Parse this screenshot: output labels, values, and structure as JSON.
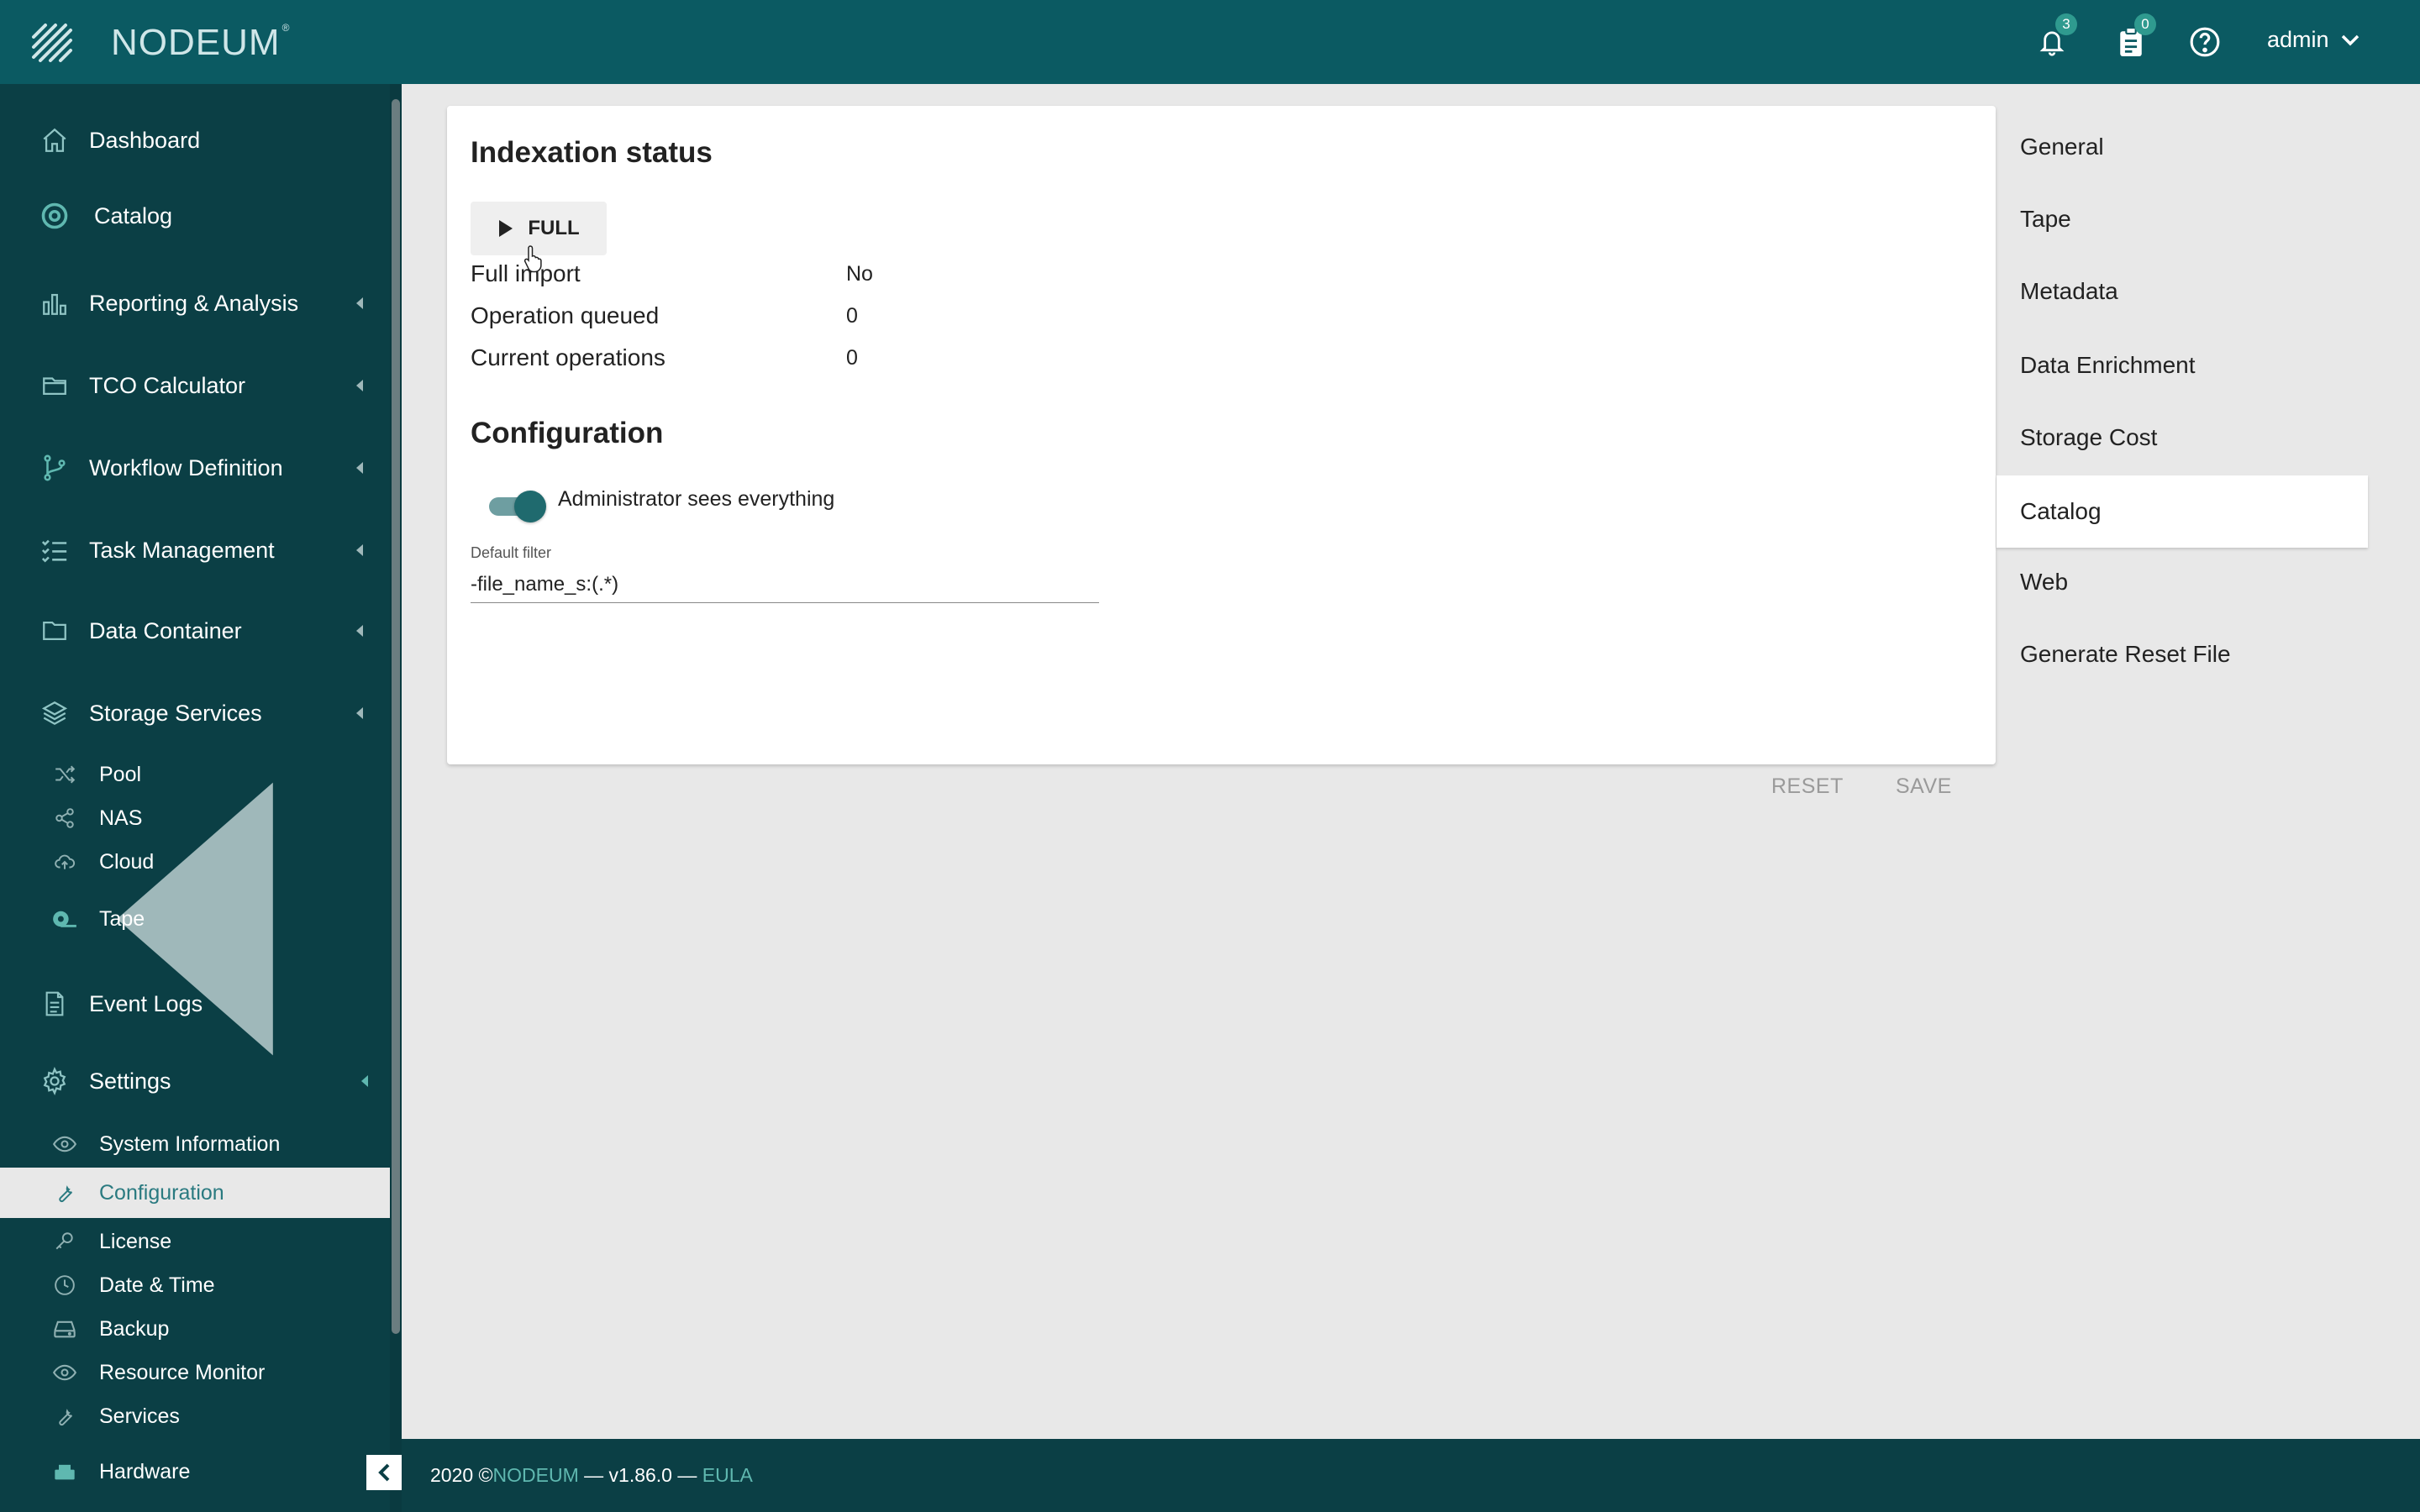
{
  "topbar": {
    "brand": "NODEUM",
    "brand_mark": "®",
    "notifications_count": "3",
    "tasks_count": "0",
    "user": "admin"
  },
  "sidebar": {
    "items": [
      {
        "label": "Dashboard",
        "icon": "home-icon"
      },
      {
        "label": "Catalog",
        "icon": "catalog-icon"
      },
      {
        "label": "Reporting & Analysis",
        "icon": "chart-icon"
      },
      {
        "label": "TCO Calculator",
        "icon": "folder-icon"
      },
      {
        "label": "Workflow Definition",
        "icon": "branch-icon"
      },
      {
        "label": "Task Management",
        "icon": "tasklist-icon"
      },
      {
        "label": "Data Container",
        "icon": "folder-icon"
      },
      {
        "label": "Storage Services",
        "icon": "layers-icon"
      },
      {
        "label": "Event Logs",
        "icon": "document-icon"
      },
      {
        "label": "Settings",
        "icon": "gear-icon"
      }
    ],
    "storage_sub": [
      {
        "label": "Pool",
        "icon": "shuffle-icon"
      },
      {
        "label": "NAS",
        "icon": "share-icon"
      },
      {
        "label": "Cloud",
        "icon": "cloud-upload-icon"
      },
      {
        "label": "Tape",
        "icon": "tape-icon"
      }
    ],
    "settings_sub": [
      {
        "label": "System Information",
        "icon": "eye-icon"
      },
      {
        "label": "Configuration",
        "icon": "wrench-icon"
      },
      {
        "label": "License",
        "icon": "key-icon"
      },
      {
        "label": "Date & Time",
        "icon": "clock-icon"
      },
      {
        "label": "Backup",
        "icon": "drive-icon"
      },
      {
        "label": "Resource Monitor",
        "icon": "eye-icon"
      },
      {
        "label": "Services",
        "icon": "wrench-icon"
      },
      {
        "label": "Hardware",
        "icon": "hardware-icon"
      }
    ]
  },
  "main": {
    "indexation_title": "Indexation status",
    "full_button": "FULL",
    "rows": [
      {
        "label": "Full import",
        "value": "No"
      },
      {
        "label": "Operation queued",
        "value": "0"
      },
      {
        "label": "Current operations",
        "value": "0"
      }
    ],
    "configuration_title": "Configuration",
    "toggle_label": "Administrator sees everything",
    "toggle_on": true,
    "filter_label": "Default filter",
    "filter_value": "-file_name_s:(.*)",
    "reset": "RESET",
    "save": "SAVE"
  },
  "right_nav": {
    "items": [
      "General",
      "Tape",
      "Metadata",
      "Data Enrichment",
      "Storage Cost",
      "Catalog",
      "Web",
      "Generate Reset File"
    ],
    "active": "Catalog"
  },
  "footer": {
    "year": "2020 © ",
    "brand": "NODEUM",
    "version": " — v1.86.0 — ",
    "eula": "EULA"
  },
  "colors": {
    "topbar": "#0b5a62",
    "sidebar": "#0b3f45",
    "accent": "#2a7a80",
    "badge": "#2f9a8f"
  }
}
